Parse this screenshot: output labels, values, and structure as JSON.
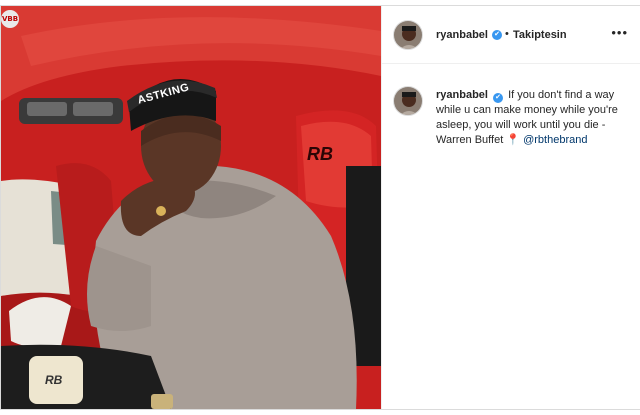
{
  "photo": {
    "corner_badge": "VBB",
    "hat_text": "ASTKING",
    "seat_logo": "RB",
    "phone_logo": "RB"
  },
  "header": {
    "username": "ryanbabel",
    "verified_mark": "✔",
    "separator": "•",
    "follow_label": "Takiptesin",
    "more_label": "•••"
  },
  "caption": {
    "username": "ryanbabel",
    "verified_mark": "✔",
    "text": "If you don't find a way while u can make money while you're asleep, you will work until you die - Warren Buffet",
    "pin_icon": "📍",
    "mention": "@rbthebrand"
  },
  "colors": {
    "accent": "#3897f0",
    "seat_red": "#d42424",
    "text": "#262626"
  }
}
